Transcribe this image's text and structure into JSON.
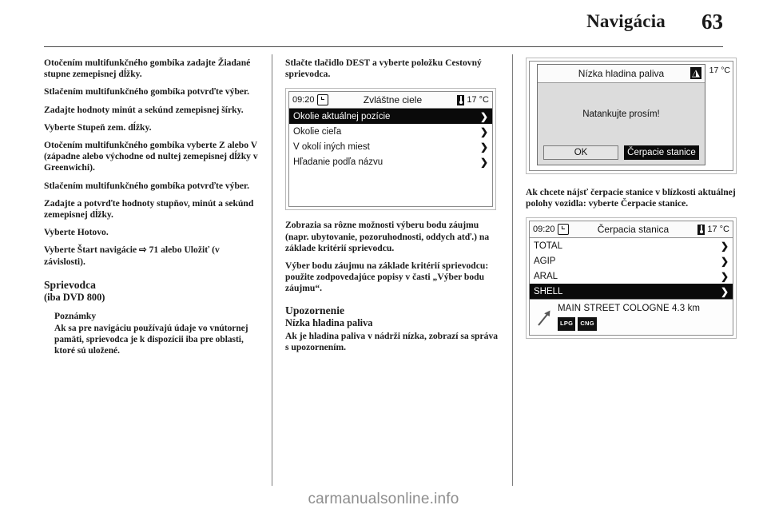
{
  "header": {
    "title": "Navigácia",
    "page_number": "63"
  },
  "column1": {
    "paragraphs": [
      "Otočením multifunkčného gombíka zadajte Žiadané stupne zemepisnej dĺžky.",
      "Stlačením multifunkčného gombíka potvrďte výber.",
      "Zadajte hodnoty minút a sekúnd zemepisnej šírky.",
      "Vyberte Stupeň zem. dĺžky.",
      "Otočením multifunkčného gombíka vyberte Z alebo V (západne alebo východne od nultej zemepisnej dĺžky v Greenwichi).",
      "Stlačením multifunkčného gombíka potvrďte výber.",
      "Zadajte a potvrďte hodnoty stupňov, minút a sekúnd zemepisnej dĺžky.",
      "Vyberte Hotovo.",
      "Vyberte Štart navigácie ⇨ 71 alebo Uložiť (v závislosti)."
    ],
    "section_heading": "Sprievodca",
    "section_subheading": "(iba DVD 800)",
    "note_title": "Poznámky",
    "note_body": "Ak sa pre navigáciu používajú údaje vo vnútornej pamäti, sprievodca je k dispozícii iba pre oblasti, ktoré sú uložené."
  },
  "column2": {
    "intro": "Stlačte tlačidlo DEST a vyberte položku Cestovný sprievodca.",
    "screen": {
      "clock": "09:20",
      "title": "Zvláštne ciele",
      "temperature": "17 °C",
      "rows": [
        {
          "label": "Okolie aktuálnej pozície",
          "selected": true
        },
        {
          "label": "Okolie cieľa",
          "selected": false
        },
        {
          "label": "V okolí iných miest",
          "selected": false
        },
        {
          "label": "Hľadanie podľa názvu",
          "selected": false
        }
      ]
    },
    "after_screen": [
      "Zobrazia sa rôzne možnosti výberu bodu záujmu (napr. ubytovanie, pozoruhodnosti, oddych atď.) na základe kritérií sprievodcu.",
      "Výber bodu záujmu na základe kritérií sprievodcu: použite zodpovedajúce popisy v časti „Výber bodu záujmu“."
    ],
    "notice_heading": "Upozornenie",
    "notice_subheading": "Nízka hladina paliva",
    "notice_body": "Ak je hladina paliva v nádrži nízka, zobrazí sa správa s upozornením."
  },
  "column3": {
    "dialog": {
      "temperature": "17 °C",
      "title": "Nízka hladina paliva",
      "message": "Natankujte prosím!",
      "buttons": [
        {
          "label": "OK",
          "selected": false
        },
        {
          "label": "Čerpacie stanice",
          "selected": true
        }
      ]
    },
    "middle_text": "Ak chcete nájsť čerpacie stanice v blízkosti aktuálnej polohy vozidla: vyberte Čerpacie stanice.",
    "screen": {
      "clock": "09:20",
      "title": "Čerpacia stanica",
      "temperature": "17 °C",
      "rows": [
        {
          "label": "TOTAL",
          "selected": false
        },
        {
          "label": "AGIP",
          "selected": false
        },
        {
          "label": "ARAL",
          "selected": false
        },
        {
          "label": "SHELL",
          "selected": true
        }
      ],
      "detail_address": "MAIN STREET  COLOGNE 4.3  km",
      "fuel_tags": [
        "LPG",
        "CNG"
      ]
    }
  },
  "footer": {
    "watermark": "carmanualsonline.info"
  },
  "icons": {
    "chevron": "❯",
    "clock": "clock-icon",
    "thermometer": "thermometer-icon",
    "warning": "warning-triangle-icon",
    "direction": "direction-arrow-icon"
  }
}
